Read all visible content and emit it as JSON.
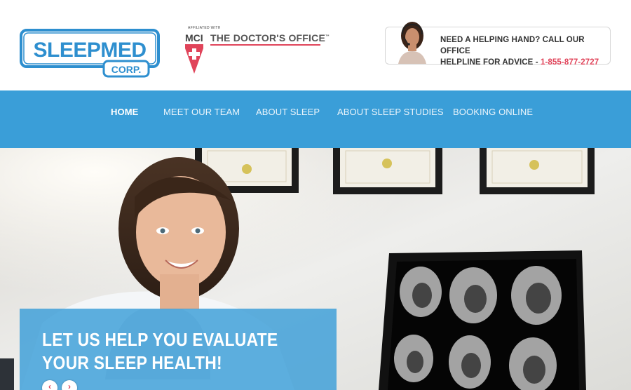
{
  "header": {
    "logo": {
      "line1": "SLEEPMED",
      "line2": "CORP."
    },
    "affiliation": {
      "small": "AFFILIATED WITH",
      "mci": "MCI",
      "name": "THE DOCTOR'S OFFICE",
      "tm": "™"
    },
    "help": {
      "line1": "NEED A HELPING HAND? CALL OUR OFFICE",
      "line2_prefix": "HELPLINE FOR ADVICE - ",
      "phone": "1-855-877-2727"
    }
  },
  "nav": {
    "items": [
      {
        "label": "HOME",
        "active": true
      },
      {
        "label": "MEET OUR TEAM"
      },
      {
        "label": "ABOUT SLEEP"
      },
      {
        "label": "ABOUT SLEEP STUDIES"
      },
      {
        "label": "BOOKING ONLINE"
      }
    ]
  },
  "hero": {
    "caption_line1": "LET US HELP YOU EVALUATE",
    "caption_line2": "YOUR SLEEP HEALTH!",
    "prev_icon": "‹",
    "next_icon": "›"
  },
  "colors": {
    "brand_blue": "#3a9ed8",
    "accent_red": "#e0445a",
    "logo_blue": "#2e8fcf"
  }
}
